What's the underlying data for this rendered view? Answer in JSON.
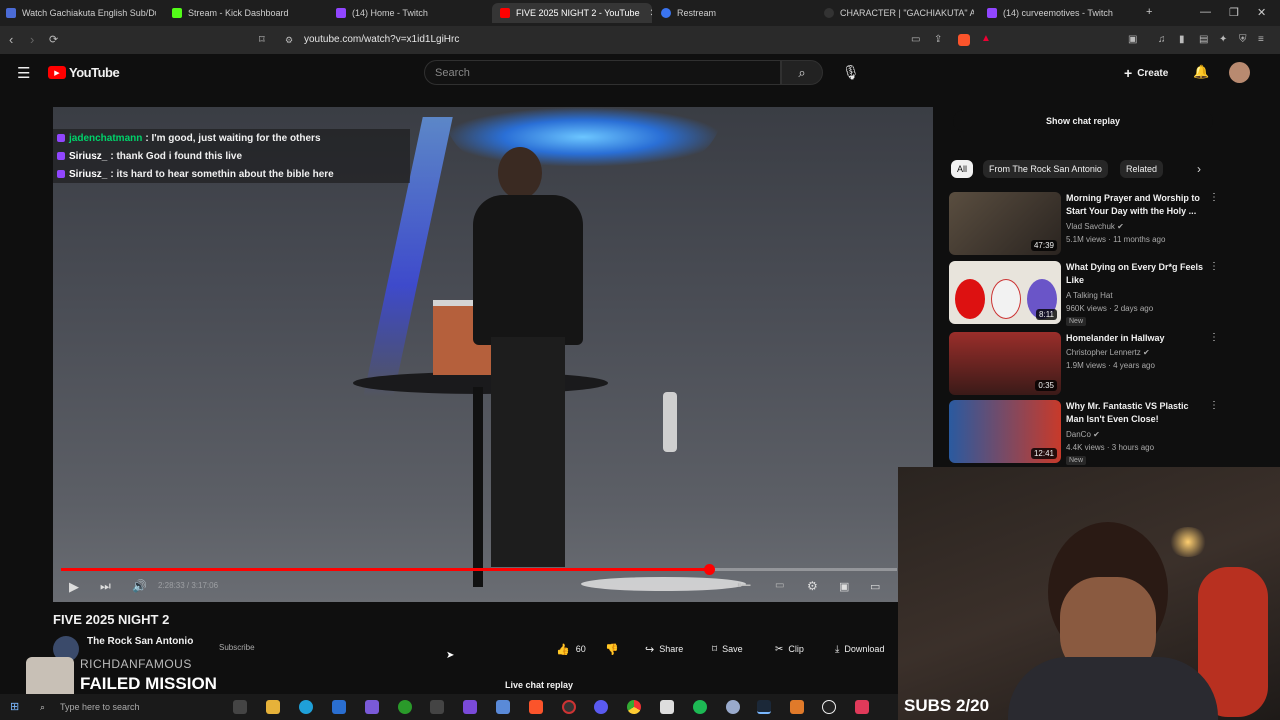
{
  "browser": {
    "tabs": [
      {
        "label": "Watch Gachiakuta English Sub/Dub ·",
        "color": "#4b6bd6"
      },
      {
        "label": "Stream - Kick Dashboard",
        "color": "#53fc18"
      },
      {
        "label": "(14) Home - Twitch",
        "color": "#9146ff"
      },
      {
        "label": "FIVE 2025 NIGHT 2 - YouTube",
        "color": "#ff0000",
        "active": true
      },
      {
        "label": "Restream",
        "color": "#3a74f0"
      },
      {
        "label": "CHARACTER | \"GACHIAKUTA\" Anim",
        "color": "#333333"
      },
      {
        "label": "(14) curveemotives - Twitch",
        "color": "#9146ff"
      }
    ],
    "url": "youtube.com/watch?v=x1id1LgiHrc"
  },
  "youtube": {
    "logo_text": "YouTube",
    "search_placeholder": "Search",
    "create_label": "Create"
  },
  "video": {
    "chat_overlay": [
      {
        "user": "jadenchatmann",
        "user_color": "#00d26a",
        "text": ": I'm good, just waiting for the others"
      },
      {
        "user": "Siriusz_",
        "user_color": "#ffffff",
        "text": ": thank God i found this live"
      },
      {
        "user": "Siriusz_",
        "user_color": "#ffffff",
        "text": ": its hard to hear somethin about the bible here"
      }
    ],
    "progress_fraction": 0.775,
    "time_display": "2:28:33 / 3:17:06",
    "title": "FIVE 2025 NIGHT 2",
    "channel": "The Rock San Antonio",
    "subscribe_label": "Subscribe",
    "likes": "60",
    "share_label": "Share",
    "save_label": "Save",
    "clip_label": "Clip",
    "download_label": "Download",
    "live_chat_replay": "Live chat replay"
  },
  "sidebar": {
    "show_chat_replay": "Show chat replay",
    "chips": [
      "All",
      "From The Rock San Antonio",
      "Related"
    ],
    "recommendations": [
      {
        "title": "Morning Prayer and Worship to Start Your Day with the Holy ...",
        "channel": "Vlad Savchuk",
        "verified": true,
        "meta": "5.1M views · 11 months ago",
        "duration": "47:39",
        "new": false,
        "thumb": "#4a4036"
      },
      {
        "title": "What Dying on Every Dr*g Feels Like",
        "channel": "A Talking Hat",
        "verified": false,
        "meta": "960K views · 2 days ago",
        "duration": "8:11",
        "new": true,
        "thumb": "#e8e4dc"
      },
      {
        "title": "Homelander in Hallway",
        "channel": "Christopher Lennertz",
        "verified": true,
        "meta": "1.9M views · 4 years ago",
        "duration": "0:35",
        "new": false,
        "thumb": "#8a2a28"
      },
      {
        "title": "Why Mr. Fantastic VS Plastic Man Isn't Even Close!",
        "channel": "DanCo",
        "verified": true,
        "meta": "4.4K views · 3 hours ago",
        "duration": "12:41",
        "new": true,
        "thumb": "#2a5aa0"
      }
    ],
    "new_label": "New"
  },
  "overlay": {
    "alert_user": "RICHDANFAMOUS",
    "alert_text": "FAILED MISSION",
    "subs_goal": "SUBS 2/20"
  },
  "taskbar": {
    "search_placeholder": "Type here to search"
  }
}
